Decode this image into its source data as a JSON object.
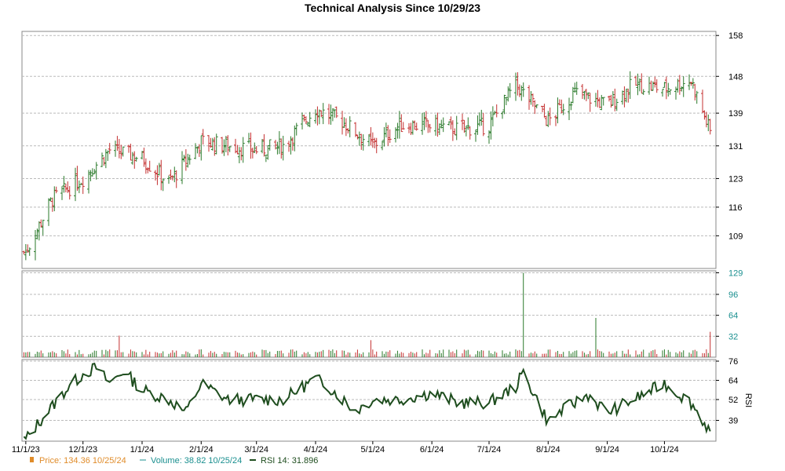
{
  "chart_data": {
    "type": "line",
    "title": "Technical Analysis Since 10/29/23",
    "x_tick_labels": [
      "11/1/23",
      "12/1/23",
      "1/1/24",
      "2/1/24",
      "3/1/24",
      "4/1/24",
      "5/1/24",
      "6/1/24",
      "7/1/24",
      "8/1/24",
      "9/1/24",
      "10/1/24"
    ],
    "price_panel": {
      "yticks": [
        "158",
        "148",
        "139",
        "131",
        "123",
        "116",
        "109"
      ],
      "ylim": [
        101,
        159
      ],
      "series_name": "Price",
      "color_up": "#2a7a2a",
      "color_down": "#c43030",
      "points": [
        [
          "11/1/23",
          105
        ],
        [
          "11/15/23",
          118
        ],
        [
          "12/1/23",
          123
        ],
        [
          "12/15/23",
          130
        ],
        [
          "1/1/24",
          128
        ],
        [
          "1/15/24",
          122
        ],
        [
          "2/1/24",
          132
        ],
        [
          "2/15/24",
          131
        ],
        [
          "3/1/24",
          130
        ],
        [
          "3/15/24",
          131
        ],
        [
          "4/1/24",
          140
        ],
        [
          "4/15/24",
          137
        ],
        [
          "5/1/24",
          131
        ],
        [
          "5/15/24",
          136
        ],
        [
          "6/1/24",
          136
        ],
        [
          "6/15/24",
          135
        ],
        [
          "7/1/24",
          136
        ],
        [
          "7/15/24",
          146
        ],
        [
          "8/1/24",
          137
        ],
        [
          "8/15/24",
          144
        ],
        [
          "9/1/24",
          141
        ],
        [
          "9/15/24",
          146
        ],
        [
          "10/1/24",
          145
        ],
        [
          "10/15/24",
          147
        ],
        [
          "10/25/24",
          134.36
        ]
      ]
    },
    "volume_panel": {
      "yticks": [
        "129",
        "96",
        "64",
        "32"
      ],
      "ylim": [
        0,
        132
      ],
      "series_name": "Volume",
      "color": "#1a8f8f",
      "spikes": [
        [
          "7/19/24",
          129
        ],
        [
          "8/26/24",
          60
        ],
        [
          "12/20/23",
          33
        ],
        [
          "4/30/24",
          26
        ],
        [
          "10/25/24",
          38.82
        ]
      ]
    },
    "rsi_panel": {
      "yticks": [
        "76",
        "64",
        "52",
        "39"
      ],
      "ylim": [
        26,
        77
      ],
      "ylabel": "RSI",
      "series_name": "RSI 14",
      "color": "#1e4d1e",
      "points": [
        [
          "11/1/23",
          27
        ],
        [
          "11/8/23",
          38
        ],
        [
          "11/22/23",
          58
        ],
        [
          "12/1/23",
          68
        ],
        [
          "12/8/23",
          72
        ],
        [
          "12/15/23",
          62
        ],
        [
          "12/22/23",
          70
        ],
        [
          "1/1/24",
          58
        ],
        [
          "1/15/24",
          52
        ],
        [
          "1/24/24",
          44
        ],
        [
          "2/1/24",
          62
        ],
        [
          "2/15/24",
          52
        ],
        [
          "3/1/24",
          52
        ],
        [
          "3/15/24",
          52
        ],
        [
          "4/1/24",
          65
        ],
        [
          "4/8/24",
          60
        ],
        [
          "4/22/24",
          45
        ],
        [
          "5/1/24",
          52
        ],
        [
          "5/15/24",
          52
        ],
        [
          "6/1/24",
          56
        ],
        [
          "6/15/24",
          50
        ],
        [
          "7/1/24",
          50
        ],
        [
          "7/15/24",
          60
        ],
        [
          "7/19/24",
          69
        ],
        [
          "8/1/24",
          38
        ],
        [
          "8/8/24",
          45
        ],
        [
          "8/22/24",
          55
        ],
        [
          "9/1/24",
          44
        ],
        [
          "9/15/24",
          52
        ],
        [
          "10/1/24",
          62
        ],
        [
          "10/15/24",
          50
        ],
        [
          "10/25/24",
          31.896
        ]
      ]
    },
    "legend": [
      {
        "label": "Price: 134.36  10/25/24",
        "color": "#e08c2a"
      },
      {
        "label": "Volume: 38.82  10/25/24",
        "color": "#1a8f8f"
      },
      {
        "label": "RSI 14: 31.896",
        "color": "#1e4d1e"
      }
    ],
    "grid": true,
    "legend_position": "bottom-left"
  }
}
